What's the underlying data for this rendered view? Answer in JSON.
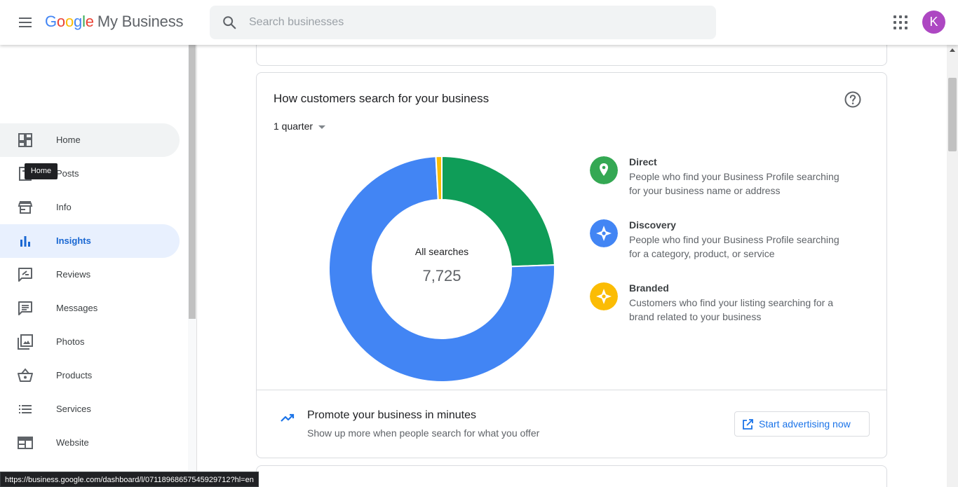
{
  "header": {
    "logo_google": [
      "G",
      "o",
      "o",
      "g",
      "l",
      "e"
    ],
    "logo_suffix": "My Business",
    "search_placeholder": "Search businesses",
    "avatar_initial": "K"
  },
  "sidebar": {
    "items": [
      {
        "label": "Home",
        "icon": "dashboard-icon"
      },
      {
        "label": "Posts",
        "icon": "posts-icon"
      },
      {
        "label": "Info",
        "icon": "store-icon"
      },
      {
        "label": "Insights",
        "icon": "bar-chart-icon"
      },
      {
        "label": "Reviews",
        "icon": "rate-review-icon"
      },
      {
        "label": "Messages",
        "icon": "message-icon"
      },
      {
        "label": "Photos",
        "icon": "photo-library-icon"
      },
      {
        "label": "Products",
        "icon": "basket-icon"
      },
      {
        "label": "Services",
        "icon": "list-icon"
      },
      {
        "label": "Website",
        "icon": "web-icon"
      }
    ],
    "active": "Insights",
    "tooltip": "Home"
  },
  "status_url": "https://business.google.com/dashboard/l/07118968657545929712?hl=en",
  "card": {
    "title": "How customers search for your business",
    "range_label": "1 quarter",
    "center_label": "All searches",
    "center_value": "7,725",
    "legend": [
      {
        "name": "Direct",
        "desc": "People who find your Business Profile searching for your business name or address",
        "color": "#0f9d58"
      },
      {
        "name": "Discovery",
        "desc": "People who find your Business Profile searching for a category, product, or service",
        "color": "#4285f4"
      },
      {
        "name": "Branded",
        "desc": "Customers who find your listing searching for a brand related to your business",
        "color": "#fbbc04"
      }
    ],
    "promo_title": "Promote your business in minutes",
    "promo_sub": "Show up more when people search for what you offer",
    "advertise_label": "Start advertising now"
  },
  "chart_data": {
    "type": "pie",
    "categories": [
      "Direct",
      "Discovery",
      "Branded"
    ],
    "values": [
      1886,
      5774,
      65
    ],
    "total": 7725,
    "colors": [
      "#0f9d58",
      "#4285f4",
      "#fbbc04"
    ]
  }
}
